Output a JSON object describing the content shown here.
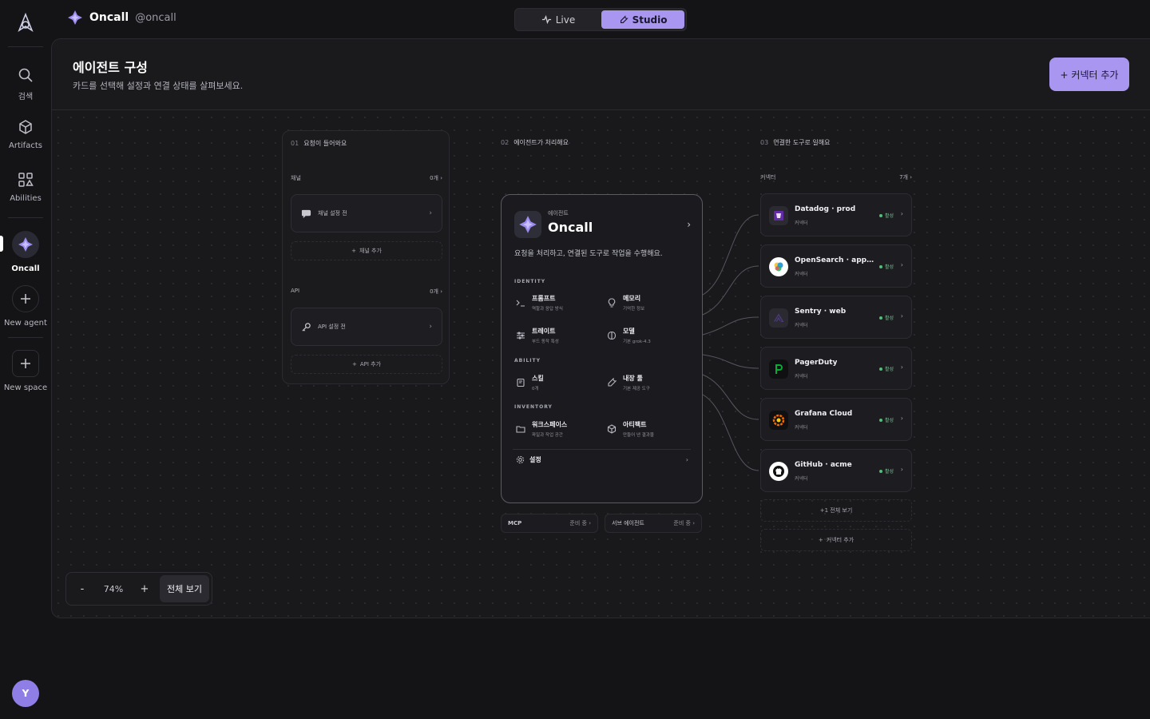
{
  "rail": {
    "items": [
      {
        "label": "검색",
        "icon": "search-icon"
      },
      {
        "label": "Artifacts",
        "icon": "cube-icon"
      },
      {
        "label": "Abilities",
        "icon": "grid-icon"
      },
      {
        "label": "Oncall",
        "icon": "sparkle-icon"
      },
      {
        "label": "New agent",
        "icon": "plus-icon"
      },
      {
        "label": "New space",
        "icon": "plus-icon"
      }
    ],
    "avatar": "Y"
  },
  "header": {
    "agent_name": "Oncall",
    "handle": "@oncall",
    "modes": [
      "Live",
      "Studio"
    ],
    "active_mode": "Studio"
  },
  "panel": {
    "title": "에이전트 구성",
    "subtitle": "카드를 선택해 설정과 연결 상태를 살펴보세요.",
    "add_connector": "+ 커넥터 추가"
  },
  "column1": {
    "num": "01",
    "title": "요청이 들어와요",
    "channel": {
      "label": "채널",
      "count": "0개",
      "slot": "채널 설정 전",
      "add": "채널 추가"
    },
    "api": {
      "label": "API",
      "count": "0개",
      "slot": "API 설정 전",
      "add": "API 추가"
    }
  },
  "column2": {
    "num": "02",
    "title": "에이전트가 처리해요",
    "agent": {
      "kicker": "에이전트",
      "name": "Oncall",
      "description": "요청을 처리하고, 연결된 도구로 작업을 수행해요.",
      "groups": {
        "identity": "IDENTITY",
        "ability": "ABILITY",
        "inventory": "INVENTORY"
      },
      "features": {
        "prompt": {
          "title": "프롬프트",
          "sub": "역할과 응답 방식"
        },
        "memory": {
          "title": "메모리",
          "sub": "기억한 정보"
        },
        "traits": {
          "title": "트레이트",
          "sub": "부드 동작 특성"
        },
        "model": {
          "title": "모델",
          "sub": "기본 grok-4.3"
        },
        "skills": {
          "title": "스킬",
          "sub": "0개"
        },
        "tools": {
          "title": "내장 툴",
          "sub": "기본 제공 도구"
        },
        "workspace": {
          "title": "워크스페이스",
          "sub": "파일과 작업 공간"
        },
        "artifacts": {
          "title": "아티팩트",
          "sub": "만들어 낸 결과물"
        }
      },
      "settings": "설정"
    },
    "mcp": {
      "label": "MCP",
      "status": "준비 중"
    },
    "sub_agent": {
      "label": "서브 에이전트",
      "status": "준비 중"
    }
  },
  "column3": {
    "num": "03",
    "title": "연결한 도구로 일해요",
    "section_label": "커넥터",
    "count": "7개",
    "type_label": "커넥터",
    "status_label": "활성",
    "connectors": [
      {
        "name": "Datadog · prod",
        "icon": "datadog-icon"
      },
      {
        "name": "OpenSearch · app-logs",
        "icon": "opensearch-icon"
      },
      {
        "name": "Sentry · web",
        "icon": "sentry-icon"
      },
      {
        "name": "PagerDuty",
        "icon": "pagerduty-icon"
      },
      {
        "name": "Grafana Cloud",
        "icon": "grafana-icon"
      },
      {
        "name": "GitHub · acme",
        "icon": "github-icon"
      }
    ],
    "view_all": "+1 전체 보기",
    "add": "커넥터 추가"
  },
  "zoom": {
    "minus": "-",
    "value": "74%",
    "plus": "+",
    "fit": "전체 보기"
  },
  "colors": {
    "accent": "#a996f0",
    "active": "#4fbf7a",
    "background": "#141416"
  }
}
